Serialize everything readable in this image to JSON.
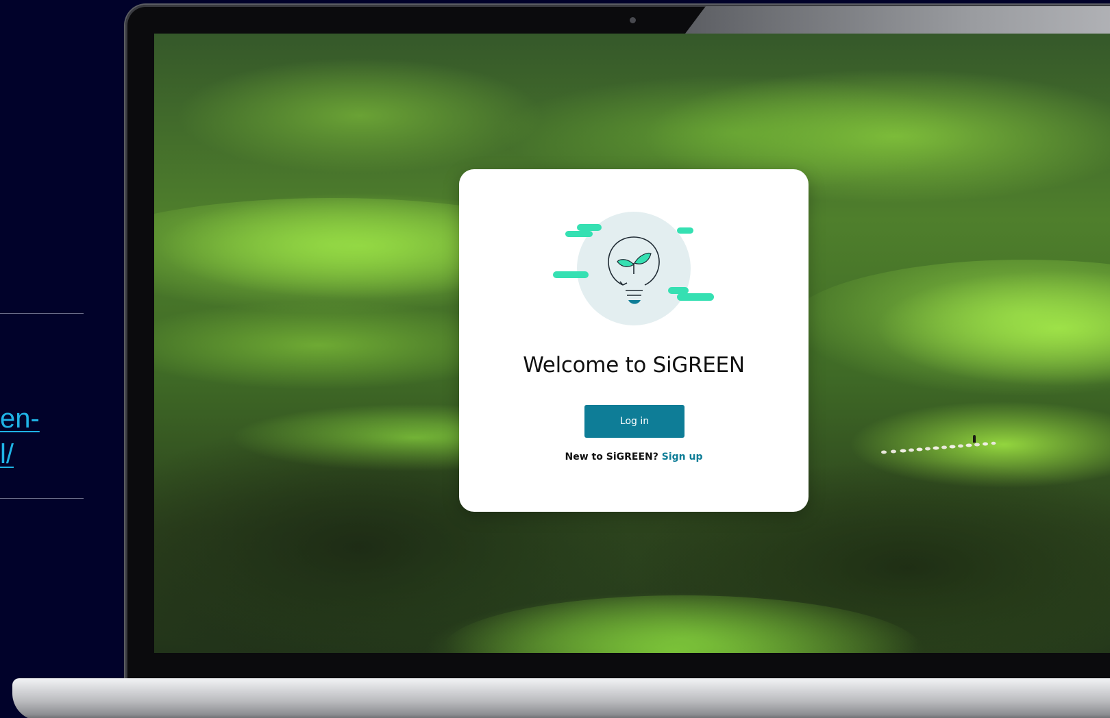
{
  "slide": {
    "link_lines": [
      "en-",
      "l/"
    ]
  },
  "login_card": {
    "title": "Welcome to SiGREEN",
    "login_button_label": "Log in",
    "signup_prompt": "New to SiGREEN?",
    "signup_link_label": "Sign up",
    "illustration_icon": "lightbulb-sprout-icon"
  },
  "colors": {
    "accent": "#0e7d97",
    "illustration_mint": "#35e0b2",
    "illustration_circle": "#e3eef0",
    "slide_background": "#01022a",
    "slide_link": "#1fb3e6"
  }
}
